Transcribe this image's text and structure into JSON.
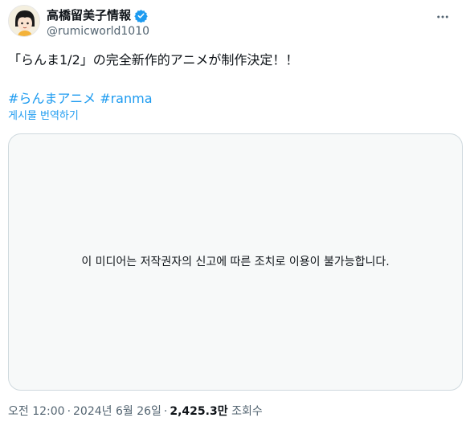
{
  "author": {
    "display_name": "高橋留美子情報",
    "handle": "@rumicworld1010",
    "verified": true,
    "avatar_icon": "anime-character-avatar"
  },
  "more_icon": "more-horizontal-icon",
  "tweet": {
    "text": "「らんま1/2」の完全新作的アニメが制作決定！！",
    "hashtags": [
      "#らんまアニメ",
      "#ranma"
    ],
    "translate_label": "게시물 번역하기"
  },
  "media": {
    "notice": "이 미디어는 저작권자의 신고에 따른 조치로 이용이 불가능합니다."
  },
  "meta": {
    "time": "오전 12:00",
    "date": "2024년 6월 26일",
    "views_count": "2,425.3만",
    "views_label": "조회수"
  },
  "colors": {
    "link": "#1d9bf0",
    "secondary_text": "#536471",
    "verified_badge": "#1d9bf0",
    "media_bg": "#f7f9f9",
    "border": "#cfd9de"
  }
}
